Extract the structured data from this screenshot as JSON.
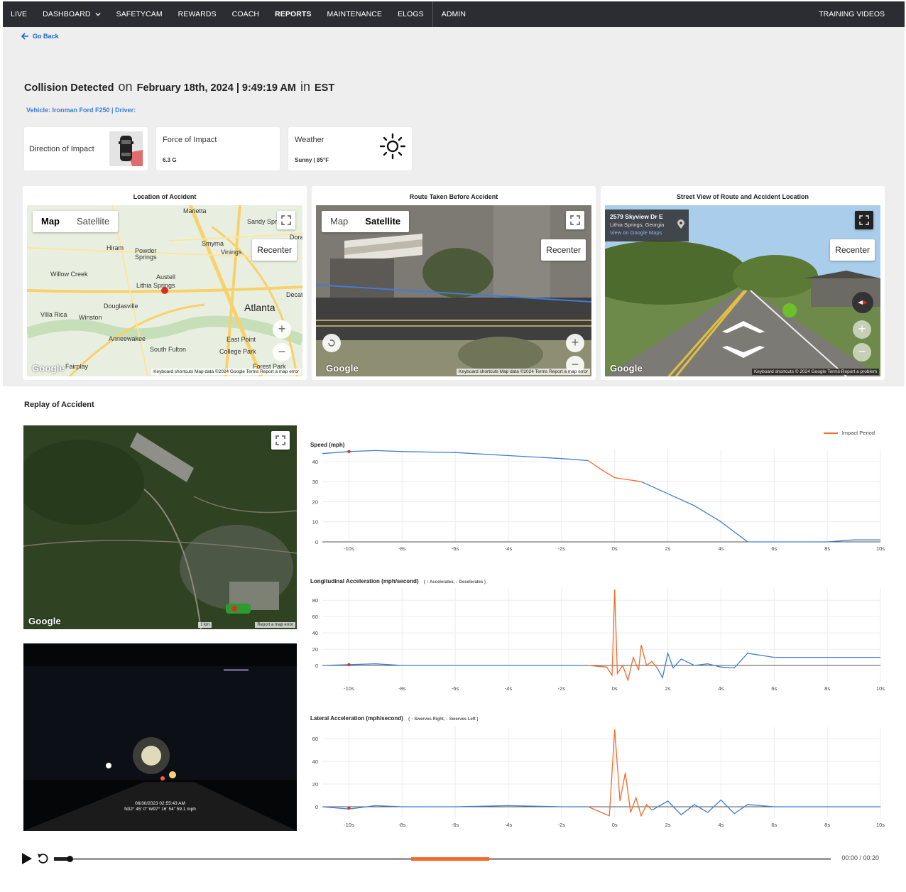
{
  "nav": {
    "items": [
      {
        "label": "LIVE",
        "active": false
      },
      {
        "label": "DASHBOARD",
        "active": false,
        "has_dropdown": true
      },
      {
        "label": "SAFETYCAM",
        "active": false
      },
      {
        "label": "REWARDS",
        "active": false
      },
      {
        "label": "COACH",
        "active": false
      },
      {
        "label": "REPORTS",
        "active": true
      },
      {
        "label": "MAINTENANCE",
        "active": false
      },
      {
        "label": "ELOGS",
        "active": false
      },
      {
        "label": "ADMIN",
        "active": false
      }
    ],
    "right_link": "TRAINING VIDEOS"
  },
  "goback_label": "Go Back",
  "header": {
    "event": "Collision Detected",
    "on": "on",
    "date": "February 18th, 2024 | 9:49:19 AM",
    "in": "in",
    "timezone": "EST",
    "vehicle_line": "Vehicle: Ironman Ford F250 | Driver:"
  },
  "cards": {
    "direction": {
      "label": "Direction of Impact",
      "icon": "car-impact-icon"
    },
    "force": {
      "label": "Force of Impact",
      "value": "6.3 G"
    },
    "weather": {
      "label": "Weather",
      "value": "Sunny | 85°F",
      "icon": "sun-icon"
    }
  },
  "panels": {
    "location": {
      "title": "Location of Accident",
      "map_tab": "Map",
      "satellite_tab": "Satellite",
      "selected": "Map",
      "recenter": "Recenter",
      "footer": "Keyboard shortcuts   Map data ©2024 Google   Terms   Report a map error",
      "places": [
        "Marietta",
        "Sandy Spr",
        "Dora",
        "Hiram",
        "Smyrna",
        "Vinings",
        "Powder Springs",
        "Willow Creek",
        "Austell",
        "Lithia Springs",
        "Decat",
        "Douglasville",
        "Atlanta",
        "Villa Rica",
        "Winston",
        "Anneewakee",
        "East Point",
        "South Fulton",
        "College Park",
        "Forest Park",
        "Fairplay"
      ]
    },
    "route": {
      "title": "Route Taken Before Accident",
      "map_tab": "Map",
      "satellite_tab": "Satellite",
      "selected": "Satellite",
      "recenter": "Recenter",
      "footer": "Keyboard shortcuts   Map data ©2024   Terms   Report a map error"
    },
    "street": {
      "title": "Street View of Route and Accident Location",
      "address": "2579 Skyview Dr E",
      "city": "Lithia Springs, Georgia",
      "view_link": "View on Google Maps",
      "recenter": "Recenter",
      "footer": "Keyboard shortcuts   © 2024 Google   Terms   Report a problem"
    }
  },
  "google_logo": "Google",
  "replay": {
    "title": "Replay of Accident",
    "map_scale": "1 km",
    "map_footer": "Report a map error",
    "video_timestamp": "06/30/2023 02:55:43 AM",
    "video_coords": "N32° 45' 0\" W97° 16' 54\"  59.1 mph",
    "legend": "Impact Period"
  },
  "chart_data": [
    {
      "type": "line",
      "title": "Speed (mph)",
      "x_ticks": [
        "-10s",
        "-8s",
        "-6s",
        "-4s",
        "-2s",
        "0s",
        "2s",
        "4s",
        "6s",
        "8s",
        "10s"
      ],
      "yticks": [
        0,
        10,
        20,
        30,
        40
      ],
      "ylim": [
        0,
        46
      ],
      "xlim": [
        -11,
        10
      ],
      "series": [
        {
          "role": "normal",
          "color": "#3f7dd4",
          "points": [
            [
              -11,
              44
            ],
            [
              -10,
              45
            ],
            [
              -9,
              45.5
            ],
            [
              -8,
              45
            ],
            [
              -6,
              44.5
            ],
            [
              -4,
              43
            ],
            [
              -2,
              41.5
            ],
            [
              -1,
              40.5
            ]
          ]
        },
        {
          "role": "impact",
          "color": "#f26b2b",
          "points": [
            [
              -1,
              40.5
            ],
            [
              -0.5,
              36
            ],
            [
              0,
              32
            ],
            [
              1,
              30
            ]
          ]
        },
        {
          "role": "normal",
          "color": "#3f7dd4",
          "points": [
            [
              1,
              30
            ],
            [
              2,
              24
            ],
            [
              3,
              18
            ],
            [
              4,
              10
            ],
            [
              5,
              0
            ],
            [
              6,
              0
            ],
            [
              8,
              0
            ],
            [
              9,
              1
            ],
            [
              10,
              1
            ]
          ]
        }
      ],
      "marker": [
        -10,
        45
      ]
    },
    {
      "type": "line",
      "title": "Longitudinal Acceleration (mph/second)",
      "note": "( ↑ Accelerates,  ↓ Decelerates )",
      "x_ticks": [
        "-10s",
        "-8s",
        "-6s",
        "-4s",
        "-2s",
        "0s",
        "2s",
        "4s",
        "6s",
        "8s",
        "10s"
      ],
      "yticks": [
        0,
        20,
        40,
        60,
        80
      ],
      "ylim": [
        -20,
        95
      ],
      "xlim": [
        -11,
        10
      ],
      "series": [
        {
          "role": "normal",
          "color": "#3f7dd4",
          "points": [
            [
              -11,
              0
            ],
            [
              -10,
              1
            ],
            [
              -9,
              2
            ],
            [
              -8,
              0
            ],
            [
              -6,
              0
            ],
            [
              -4,
              0
            ],
            [
              -2,
              0
            ],
            [
              -1,
              0
            ]
          ]
        },
        {
          "role": "impact",
          "color": "#f26b2b",
          "points": [
            [
              -1,
              0
            ],
            [
              -0.3,
              -2
            ],
            [
              -0.1,
              -12
            ],
            [
              0,
              93
            ],
            [
              0.1,
              -10
            ],
            [
              0.3,
              0
            ],
            [
              0.5,
              -18
            ],
            [
              0.7,
              10
            ],
            [
              0.9,
              -6
            ],
            [
              1,
              25
            ],
            [
              1.2,
              0
            ],
            [
              1.4,
              5
            ],
            [
              1.6,
              -3
            ]
          ]
        },
        {
          "role": "normal",
          "color": "#3f7dd4",
          "points": [
            [
              1.6,
              -3
            ],
            [
              1.8,
              -15
            ],
            [
              2,
              15
            ],
            [
              2.2,
              -3
            ],
            [
              2.5,
              8
            ],
            [
              3,
              0
            ],
            [
              3.5,
              2
            ],
            [
              4,
              -2
            ],
            [
              4.5,
              -3
            ],
            [
              5,
              15
            ],
            [
              6,
              10
            ],
            [
              7,
              10
            ],
            [
              8,
              10
            ],
            [
              9,
              10
            ],
            [
              10,
              10
            ]
          ]
        }
      ],
      "marker": [
        -10,
        1
      ]
    },
    {
      "type": "line",
      "title": "Lateral Acceleration (mph/second)",
      "note": "( ↑ Swerves Right,  ↓ Swerves Left )",
      "x_ticks": [
        "-10s",
        "-8s",
        "-6s",
        "-4s",
        "-2s",
        "0s",
        "2s",
        "4s",
        "6s",
        "8s",
        "10s"
      ],
      "yticks": [
        0,
        20,
        40,
        60
      ],
      "ylim": [
        -10,
        70
      ],
      "xlim": [
        -11,
        10
      ],
      "series": [
        {
          "role": "normal",
          "color": "#3f7dd4",
          "points": [
            [
              -11,
              0
            ],
            [
              -10,
              -2
            ],
            [
              -9,
              1
            ],
            [
              -8,
              0
            ],
            [
              -6,
              0
            ],
            [
              -4,
              1
            ],
            [
              -2,
              0
            ],
            [
              -1,
              0
            ]
          ]
        },
        {
          "role": "impact",
          "color": "#f26b2b",
          "points": [
            [
              -1,
              0
            ],
            [
              -0.2,
              -8
            ],
            [
              0,
              68
            ],
            [
              0.2,
              5
            ],
            [
              0.4,
              30
            ],
            [
              0.6,
              -5
            ],
            [
              0.8,
              8
            ],
            [
              1,
              -8
            ],
            [
              1.2,
              2
            ],
            [
              1.4,
              -3
            ]
          ]
        },
        {
          "role": "normal",
          "color": "#3f7dd4",
          "points": [
            [
              1.4,
              -3
            ],
            [
              2,
              5
            ],
            [
              2.5,
              -7
            ],
            [
              3,
              2
            ],
            [
              3.5,
              -5
            ],
            [
              4,
              6
            ],
            [
              4.5,
              -6
            ],
            [
              5,
              2
            ],
            [
              6,
              0
            ],
            [
              7,
              0
            ],
            [
              8,
              0
            ],
            [
              9,
              0
            ],
            [
              10,
              0
            ]
          ]
        }
      ],
      "marker": [
        -10,
        -1
      ]
    }
  ],
  "player": {
    "timecode": "00:00 / 00:20",
    "progress": 0.02,
    "impact_start": 0.46,
    "impact_end": 0.56
  },
  "colors": {
    "nav_bg": "#2b2d33",
    "accent_blue": "#1a66c7",
    "series_blue": "#3f7dd4",
    "impact_orange": "#f26b2b"
  }
}
